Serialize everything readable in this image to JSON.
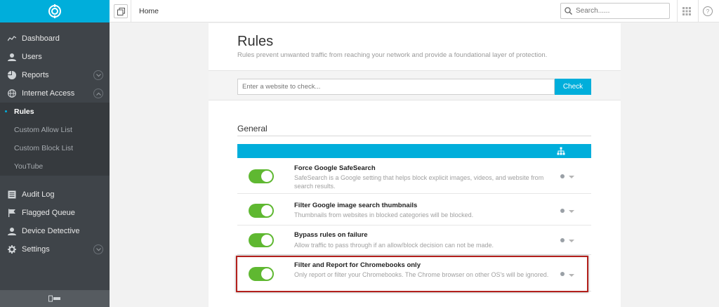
{
  "colors": {
    "accent": "#00aedb",
    "sidebar": "#3f4449",
    "toggle_on": "#5fb831",
    "highlight": "#b3201c"
  },
  "sidebar": {
    "logo": "shield-logo-icon",
    "items": [
      {
        "label": "Dashboard",
        "icon": "chart-line-icon"
      },
      {
        "label": "Users",
        "icon": "user-icon"
      },
      {
        "label": "Reports",
        "icon": "pie-chart-icon",
        "expandable": true
      },
      {
        "label": "Internet Access",
        "icon": "globe-icon",
        "expandable": true,
        "expanded": true
      }
    ],
    "sub_items": [
      {
        "label": "Rules",
        "active": true
      },
      {
        "label": "Custom Allow List"
      },
      {
        "label": "Custom Block List"
      },
      {
        "label": "YouTube"
      }
    ],
    "items_bottom": [
      {
        "label": "Audit Log",
        "icon": "list-icon"
      },
      {
        "label": "Flagged Queue",
        "icon": "flag-icon"
      },
      {
        "label": "Device Detective",
        "icon": "user-icon"
      },
      {
        "label": "Settings",
        "icon": "gear-icon",
        "expandable": true
      }
    ]
  },
  "topbar": {
    "breadcrumb": "Home",
    "search_placeholder": "Search......",
    "help": "?"
  },
  "page": {
    "title": "Rules",
    "subtitle": "Rules prevent unwanted traffic from reaching your network and provide a foundational layer of protection.",
    "check_placeholder": "Enter a website to check...",
    "check_button": "Check",
    "section": "General"
  },
  "rules": [
    {
      "title": "Force Google SafeSearch",
      "description": "SafeSearch is a Google setting that helps block explicit images, videos, and website from search results.",
      "enabled": true
    },
    {
      "title": "Filter Google image search thumbnails",
      "description": "Thumbnails from websites in blocked categories will be blocked.",
      "enabled": true
    },
    {
      "title": "Bypass rules on failure",
      "description": "Allow traffic to pass through if an allow/block decision can not be made.",
      "enabled": true
    },
    {
      "title": "Filter and Report for Chromebooks only",
      "description": "Only report or filter your Chromebooks. The Chrome browser on other OS's will be ignored.",
      "enabled": true
    }
  ]
}
